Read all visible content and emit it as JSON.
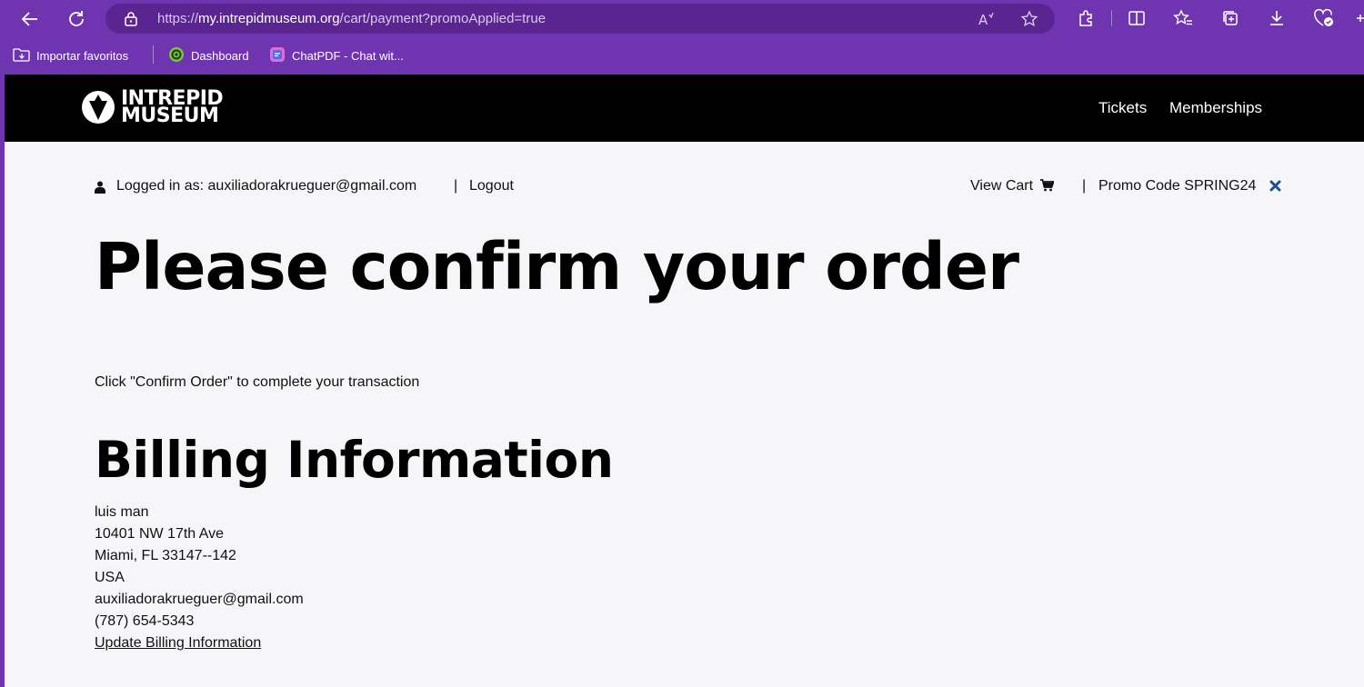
{
  "browser": {
    "url_prefix": "https://",
    "url_host": "my.intrepidmuseum.org",
    "url_path": "/cart/payment?promoApplied=true",
    "bookmarks": [
      {
        "label": "Importar favoritos",
        "icon": "folder-icon"
      },
      {
        "label": "Dashboard",
        "icon": "dashboard-favicon"
      },
      {
        "label": "ChatPDF - Chat wit...",
        "icon": "chatpdf-favicon"
      }
    ]
  },
  "site": {
    "logo_line1": "INTREPID",
    "logo_line2": "MUSEUM",
    "nav": [
      {
        "label": "Tickets"
      },
      {
        "label": "Memberships"
      }
    ]
  },
  "userbar": {
    "logged_in_text": "Logged in as: auxiliadorakrueguer@gmail.com",
    "pipe": "|",
    "logout": "Logout",
    "view_cart": "View Cart",
    "promo": "Promo Code SPRING24"
  },
  "main": {
    "title": "Please confirm your order",
    "instructions": "Click \"Confirm Order\" to complete your transaction",
    "billing_heading": "Billing Information",
    "billing": {
      "name": "luis man",
      "street": "10401 NW 17th Ave",
      "city_line": "Miami, FL 33147--142",
      "country": "USA",
      "email": "auxiliadorakrueguer@gmail.com",
      "phone": "(787) 654-5343"
    },
    "update_link": "Update Billing Information"
  },
  "colors": {
    "browser_chrome": "#6f35b0",
    "address_bar": "#5a2590",
    "header": "#000000",
    "page_bg": "#f6f6f8",
    "promo_remove": "#1d4f91"
  }
}
